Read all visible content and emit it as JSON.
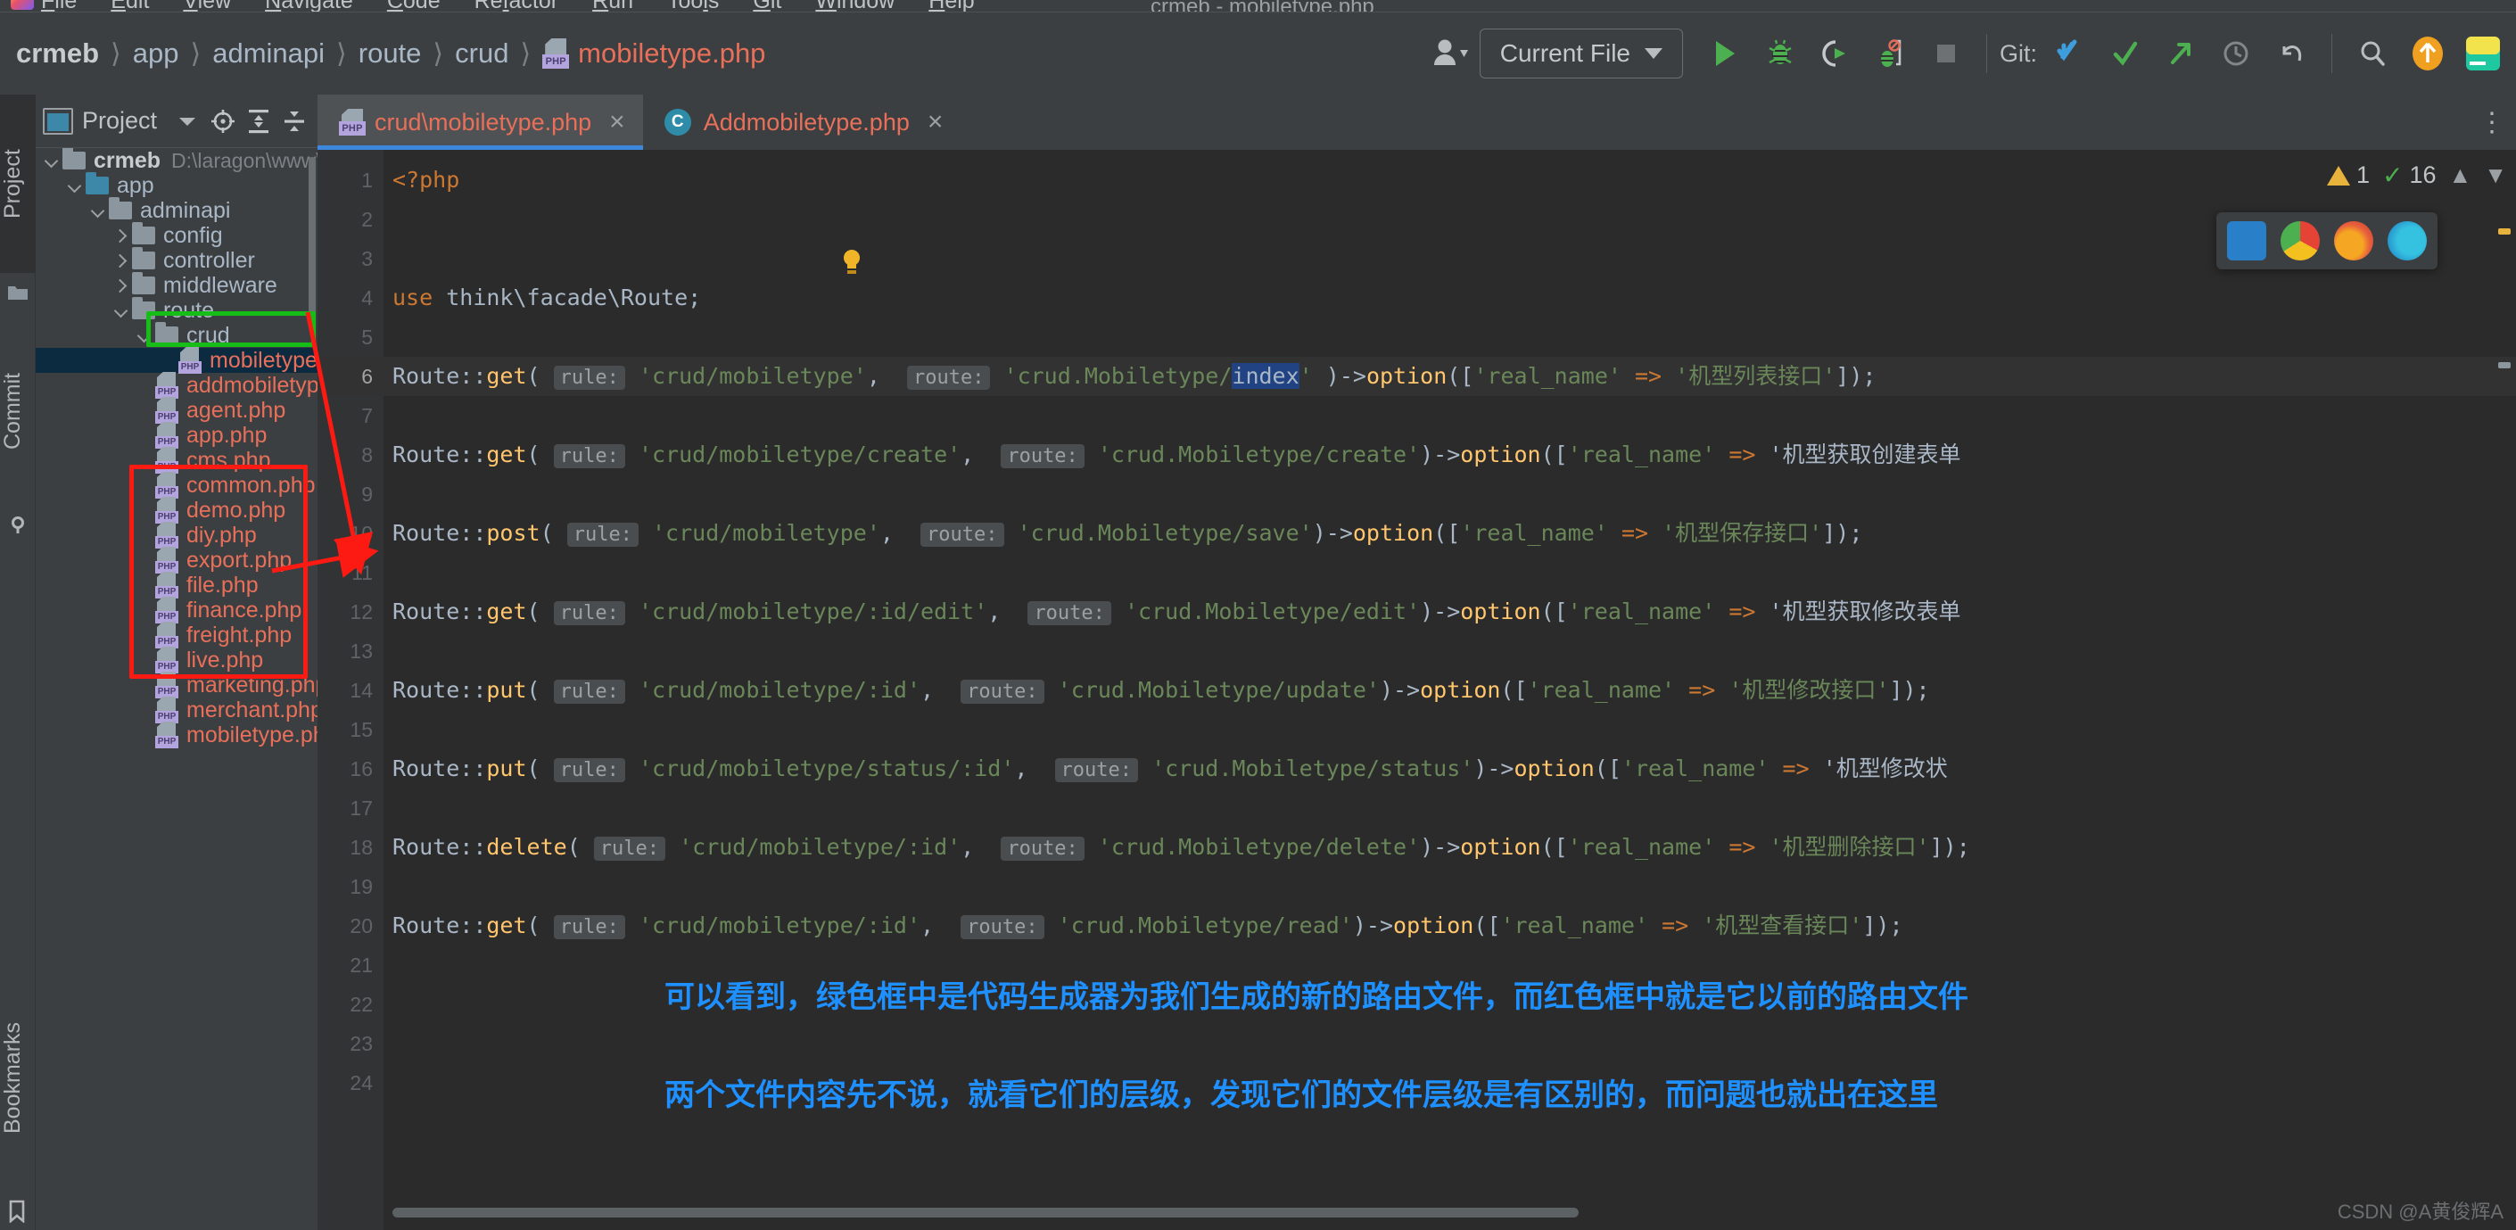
{
  "menu": {
    "items": [
      "File",
      "Edit",
      "View",
      "Navigate",
      "Code",
      "Refactor",
      "Run",
      "Tools",
      "Git",
      "Window",
      "Help"
    ],
    "window_title": "crmeb - mobiletype.php"
  },
  "breadcrumb": {
    "items": [
      "crmeb",
      "app",
      "adminapi",
      "route",
      "crud"
    ],
    "file": "mobiletype.php",
    "file_icon": "php-file-icon"
  },
  "toolbar": {
    "profile_icon": "user-avatar-icon",
    "run_config": "Current File",
    "run_icon": "run-play-icon",
    "debug_icon": "debug-bug-icon",
    "run_with_coverage_icon": "run-coverage-icon",
    "profiler_icon": "profiler-icon",
    "stop_icon": "stop-square-icon",
    "git_label": "Git:",
    "git_update_icon": "git-update-icon",
    "git_commit_icon": "git-commit-check-icon",
    "git_push_icon": "git-push-icon",
    "history_icon": "history-clock-icon",
    "undo_icon": "undo-arrow-icon",
    "search_icon": "search-magnifier-icon",
    "updates_icon": "update-available-icon",
    "ide_icon": "ide-logo-icon"
  },
  "left_strip": {
    "tabs": [
      "Project",
      "Commit",
      "Bookmarks"
    ]
  },
  "project_panel": {
    "title": "Project",
    "title_dropdown_icon": "chevron-down-icon",
    "locate_icon": "scroll-from-source-icon",
    "expand_icon": "expand-all-icon",
    "collapse_icon": "collapse-all-icon",
    "settings_icon": "gear-icon",
    "hide_icon": "hide-panel-icon",
    "tree": [
      {
        "label": "crmeb",
        "path": "D:\\laragon\\www\\crmeb",
        "kind": "folder",
        "indent": 0,
        "twisty": "down",
        "bold": true
      },
      {
        "label": "app",
        "kind": "folder-blue",
        "indent": 1,
        "twisty": "down"
      },
      {
        "label": "adminapi",
        "kind": "folder",
        "indent": 2,
        "twisty": "down"
      },
      {
        "label": "config",
        "kind": "folder",
        "indent": 3,
        "twisty": "right"
      },
      {
        "label": "controller",
        "kind": "folder",
        "indent": 3,
        "twisty": "right"
      },
      {
        "label": "middleware",
        "kind": "folder",
        "indent": 3,
        "twisty": "right"
      },
      {
        "label": "route",
        "kind": "folder",
        "indent": 3,
        "twisty": "down"
      },
      {
        "label": "crud",
        "kind": "folder",
        "indent": 4,
        "twisty": "down"
      },
      {
        "label": "mobiletype.php",
        "kind": "php",
        "indent": 5,
        "selected": true
      },
      {
        "label": "addmobiletype.php",
        "kind": "php",
        "indent": 4
      },
      {
        "label": "agent.php",
        "kind": "php",
        "indent": 4
      },
      {
        "label": "app.php",
        "kind": "php",
        "indent": 4
      },
      {
        "label": "cms.php",
        "kind": "php",
        "indent": 4
      },
      {
        "label": "common.php",
        "kind": "php",
        "indent": 4
      },
      {
        "label": "demo.php",
        "kind": "php",
        "indent": 4
      },
      {
        "label": "diy.php",
        "kind": "php",
        "indent": 4
      },
      {
        "label": "export.php",
        "kind": "php",
        "indent": 4
      },
      {
        "label": "file.php",
        "kind": "php",
        "indent": 4
      },
      {
        "label": "finance.php",
        "kind": "php",
        "indent": 4
      },
      {
        "label": "freight.php",
        "kind": "php",
        "indent": 4
      },
      {
        "label": "live.php",
        "kind": "php",
        "indent": 4
      },
      {
        "label": "marketing.php",
        "kind": "php",
        "indent": 4
      },
      {
        "label": "merchant.php",
        "kind": "php",
        "indent": 4
      },
      {
        "label": "mobiletype.php",
        "kind": "php",
        "indent": 4
      }
    ]
  },
  "editor": {
    "tabs": [
      {
        "label": "crud\\mobiletype.php",
        "icon": "php-file-icon",
        "active": true,
        "close_icon": "close-icon"
      },
      {
        "label": "Addmobiletype.php",
        "icon": "php-class-icon",
        "active": false,
        "close_icon": "close-icon"
      }
    ],
    "more_icon": "more-options-icon",
    "inspections": {
      "warning_count": "1",
      "warning_icon": "warning-triangle-icon",
      "ok_count": "16",
      "ok_icon": "inspection-check-icon",
      "prev_icon": "chevron-up-icon",
      "next_icon": "chevron-down-icon"
    },
    "browser_popup": {
      "icons": [
        "ie-browser-icon",
        "chrome-browser-icon",
        "firefox-browser-icon",
        "edge-browser-icon"
      ]
    },
    "intention_bulb_icon": "intention-bulb-icon",
    "line_numbers": [
      "1",
      "2",
      "3",
      "4",
      "5",
      "6",
      "7",
      "8",
      "9",
      "10",
      "11",
      "12",
      "13",
      "14",
      "15",
      "16",
      "17",
      "18",
      "19",
      "20",
      "21",
      "22",
      "23",
      "24"
    ],
    "current_line": 6,
    "lines": [
      {
        "n": 1,
        "tokens": [
          {
            "t": "<?php",
            "c": "kw-php"
          }
        ]
      },
      {
        "n": 2,
        "tokens": []
      },
      {
        "n": 3,
        "tokens": []
      },
      {
        "n": 4,
        "tokens": [
          {
            "t": "use ",
            "c": "kw"
          },
          {
            "t": "think\\facade\\Route;",
            "c": "plain"
          }
        ]
      },
      {
        "n": 5,
        "tokens": []
      },
      {
        "n": 6,
        "text": "Route::get( rule: 'crud/mobiletype',  route: 'crud.Mobiletype/index' )->option(['real_name' => '机型列表接口']);"
      },
      {
        "n": 7,
        "tokens": []
      },
      {
        "n": 8,
        "text": "Route::get( rule: 'crud/mobiletype/create',  route: 'crud.Mobiletype/create')->option(['real_name' => '机型获取创建表单"
      },
      {
        "n": 9,
        "tokens": []
      },
      {
        "n": 10,
        "text": "Route::post( rule: 'crud/mobiletype',  route: 'crud.Mobiletype/save')->option(['real_name' => '机型保存接口']);"
      },
      {
        "n": 11,
        "tokens": []
      },
      {
        "n": 12,
        "text": "Route::get( rule: 'crud/mobiletype/:id/edit',  route: 'crud.Mobiletype/edit')->option(['real_name' => '机型获取修改表单"
      },
      {
        "n": 13,
        "tokens": []
      },
      {
        "n": 14,
        "text": "Route::put( rule: 'crud/mobiletype/:id',  route: 'crud.Mobiletype/update')->option(['real_name' => '机型修改接口']);"
      },
      {
        "n": 15,
        "tokens": []
      },
      {
        "n": 16,
        "text": "Route::put( rule: 'crud/mobiletype/status/:id',  route: 'crud.Mobiletype/status')->option(['real_name' => '机型修改状"
      },
      {
        "n": 17,
        "tokens": []
      },
      {
        "n": 18,
        "text": "Route::delete( rule: 'crud/mobiletype/:id',  route: 'crud.Mobiletype/delete')->option(['real_name' => '机型删除接口']);"
      },
      {
        "n": 19,
        "tokens": []
      },
      {
        "n": 20,
        "text": "Route::get( rule: 'crud/mobiletype/:id',  route: 'crud.Mobiletype/read')->option(['real_name' => '机型查看接口']);"
      },
      {
        "n": 21,
        "tokens": []
      },
      {
        "n": 22,
        "tokens": []
      },
      {
        "n": 23,
        "tokens": []
      },
      {
        "n": 24,
        "tokens": []
      }
    ]
  },
  "annotations": {
    "green_box_label": "green-highlight-box",
    "red_box_label": "red-highlight-box",
    "arrow_label": "red-arrow",
    "line1": "可以看到，绿色框中是代码生成器为我们生成的新的路由文件，而红色框中就是它以前的路由文件",
    "line2": "两个文件内容先不说，就看它们的层级，发现它们的文件层级是有区别的，而问题也就出在这里"
  },
  "watermark": "CSDN @A黄俊辉A",
  "colors": {
    "accent_blue": "#3d87dd",
    "php_red": "#e8705a",
    "green_box": "#16bd16",
    "red_box": "#fd1a12",
    "anno_blue": "#1e90ff",
    "string_green": "#6a8759",
    "keyword_orange": "#cc7832"
  }
}
